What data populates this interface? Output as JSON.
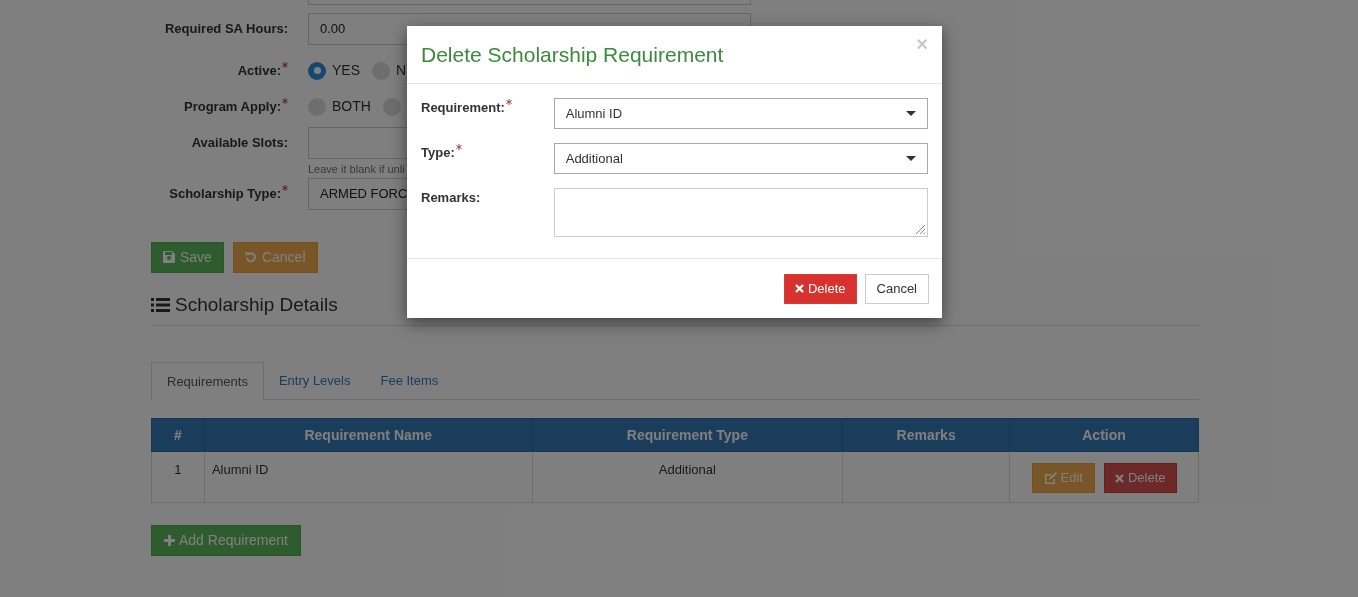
{
  "form": {
    "fields": [
      {
        "kind": "text",
        "label": "Required SA Hours:",
        "required": false,
        "value": "0.00"
      },
      {
        "kind": "radio",
        "label": "Active:",
        "required": true,
        "options": [
          {
            "label": "YES",
            "selected": true
          },
          {
            "label": "N",
            "selected": false
          }
        ]
      },
      {
        "kind": "radio",
        "label": "Program Apply:",
        "required": true,
        "options": [
          {
            "label": "BOTH",
            "selected": false
          },
          {
            "selected": false
          }
        ]
      },
      {
        "kind": "text",
        "label": "Available Slots:",
        "required": false,
        "help": "Leave it blank if unli"
      },
      {
        "kind": "select",
        "label": "Scholarship Type:",
        "required": true,
        "value": "ARMED FORC"
      }
    ],
    "buttons": [
      {
        "kind": "save",
        "label": "Save"
      },
      {
        "kind": "cancel",
        "label": "Cancel"
      }
    ]
  },
  "section": {
    "title": "Scholarship Details"
  },
  "tabs": [
    {
      "label": "Requirements",
      "selected": true
    },
    {
      "label": "Entry Levels",
      "selected": false
    },
    {
      "label": "Fee Items",
      "selected": false
    }
  ],
  "table": {
    "columns": [
      "#",
      "Requirement Name",
      "Requirement Type",
      "Remarks",
      "Action"
    ],
    "rows": [
      {
        "number": "1",
        "name": "Alumni ID",
        "type": "Additional",
        "edit": "Edit",
        "delete": "Delete"
      }
    ]
  },
  "add_button": "Add Requirement",
  "modal": {
    "title": "Delete Scholarship Requirement",
    "close": "×",
    "fields": [
      {
        "kind": "select",
        "label": "Requirement:",
        "required": true,
        "value": "Alumni ID"
      },
      {
        "kind": "select",
        "label": "Type:",
        "required": true,
        "value": "Additional"
      },
      {
        "kind": "textarea",
        "label": "Remarks:",
        "required": false
      }
    ],
    "buttons": [
      {
        "kind": "delete",
        "label": "Delete"
      },
      {
        "kind": "cancel",
        "label": "Cancel"
      }
    ]
  }
}
